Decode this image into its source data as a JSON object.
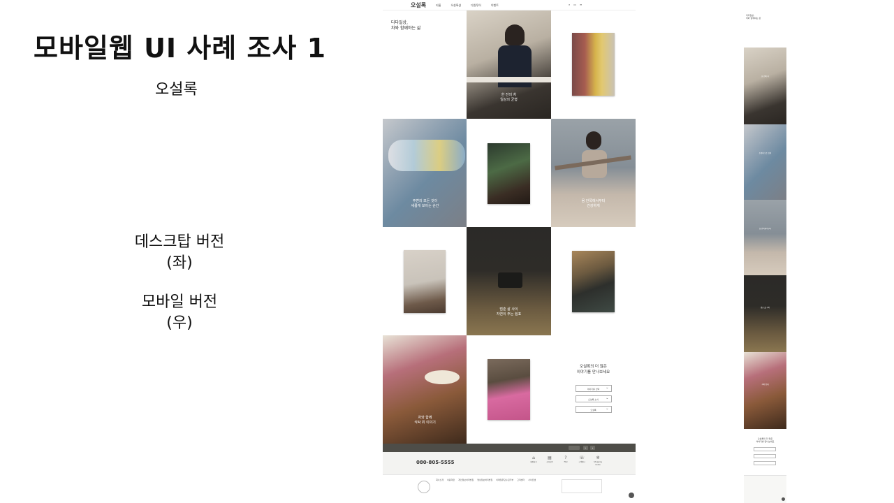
{
  "slide": {
    "title": "모바일웹 UI 사례 조사 1",
    "subtitle": "오설록",
    "desktop_label": "데스크탑 버전",
    "desktop_paren": "(좌)",
    "mobile_label": "모바일 버전",
    "mobile_paren": "(우)"
  },
  "desktop": {
    "logo": "오설록",
    "nav": [
      "티룸",
      "오설록샵",
      "다원투어",
      "이벤트"
    ],
    "intro_title_1": "다다일상,",
    "intro_title_2": "차와 함께하는 삶",
    "tile_caption_1_1": "한 잔의 차",
    "tile_caption_1_2": "일상의 균형",
    "tile_caption_2_1": "주변의 모든 것이",
    "tile_caption_2_2": "새롭게 보이는 순간",
    "tile_caption_3_1": "몸 안쪽에서부터",
    "tile_caption_3_2": "건강하게",
    "tile_caption_4_1": "멈춘 삶 사이",
    "tile_caption_4_2": "자연이 주는 쉼표",
    "tile_caption_5_1": "차와 함께",
    "tile_caption_5_2": "식탁 위 이야기",
    "story_1": "오설록의 더 많은",
    "story_2": "이야기를 만나보세요",
    "select_1": "이야기를 선택",
    "select_2": "오설록 소식",
    "select_3": "오설록",
    "phone": "080-805-5555",
    "footer_icons": [
      "매장찾기",
      "공지사항",
      "FAQ",
      "고객센터",
      "Shopping Guide"
    ],
    "footer_links": [
      "회사소개",
      "이용약관",
      "개인정보처리방침",
      "영상정보처리방침",
      "이메일무단수집거부",
      "고객센터",
      "사이트맵"
    ]
  },
  "colors": {
    "bar": "#4e4d48",
    "footer_bg": "#f3f3f1",
    "text": "#111111"
  }
}
